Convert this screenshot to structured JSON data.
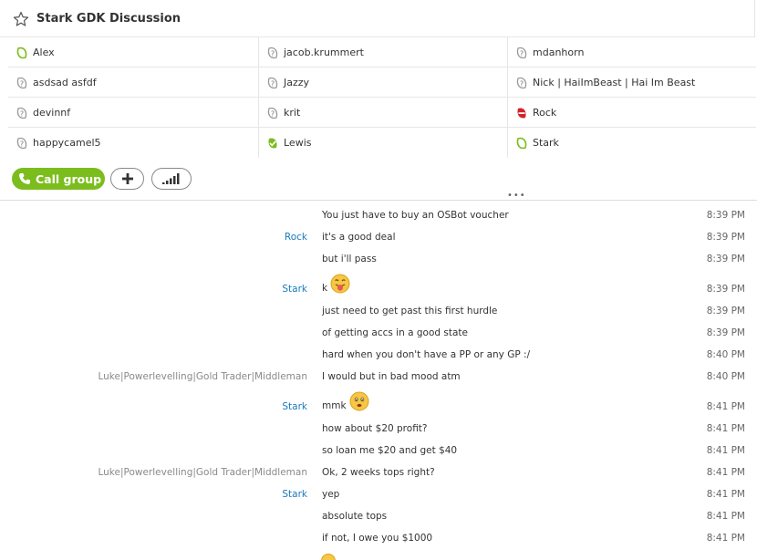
{
  "header": {
    "title": "Stark GDK Discussion"
  },
  "participants": [
    {
      "name": "Alex",
      "status": "online"
    },
    {
      "name": "jacob.krummert",
      "status": "unknown"
    },
    {
      "name": "mdanhorn",
      "status": "unknown"
    },
    {
      "name": "asdsad asfdf",
      "status": "unknown"
    },
    {
      "name": "Jazzy",
      "status": "unknown"
    },
    {
      "name": "Nick | HaiImBeast | Hai Im Beast",
      "status": "unknown"
    },
    {
      "name": "devinnf",
      "status": "unknown"
    },
    {
      "name": "krit",
      "status": "unknown"
    },
    {
      "name": "Rock",
      "status": "busy"
    },
    {
      "name": "happycamel5",
      "status": "unknown"
    },
    {
      "name": "Lewis",
      "status": "available"
    },
    {
      "name": "Stark",
      "status": "online"
    }
  ],
  "actions": {
    "call_group_label": "Call group"
  },
  "colors": {
    "accent_green": "#7cbd1e",
    "sender_blue": "#1a7bbf",
    "busy_red": "#d4222a"
  },
  "messages": [
    {
      "sender": "",
      "text": "You just have to buy an OSBot voucher",
      "time": "8:39 PM"
    },
    {
      "sender": "Rock",
      "text": "it's a good deal",
      "time": "8:39 PM"
    },
    {
      "sender": "",
      "text": "but i'll pass",
      "time": "8:39 PM"
    },
    {
      "sender": "Stark",
      "text": "k",
      "emoji": "tongue-emoji",
      "time": "8:39 PM"
    },
    {
      "sender": "",
      "text": "just need to get past this first hurdle",
      "time": "8:39 PM"
    },
    {
      "sender": "",
      "text": "of getting accs in a good state",
      "time": "8:39 PM"
    },
    {
      "sender": "",
      "text": "hard when you don't have a PP or any GP :/",
      "time": "8:40 PM"
    },
    {
      "sender": "Luke|Powerlevelling|Gold Trader|Middleman",
      "text": "I would but in bad mood atm",
      "time": "8:40 PM"
    },
    {
      "sender": "Stark",
      "text": "mmk",
      "emoji": "worried-emoji",
      "time": "8:41 PM"
    },
    {
      "sender": "",
      "text": "how about $20 profit?",
      "time": "8:41 PM"
    },
    {
      "sender": "",
      "text": "so loan me $20 and get $40",
      "time": "8:41 PM"
    },
    {
      "sender": "Luke|Powerlevelling|Gold Trader|Middleman",
      "text": "Ok, 2 weeks tops right?",
      "time": "8:41 PM"
    },
    {
      "sender": "Stark",
      "text": "yep",
      "time": "8:41 PM"
    },
    {
      "sender": "",
      "text": "absolute tops",
      "time": "8:41 PM"
    },
    {
      "sender": "",
      "text": "if not, I owe you $1000",
      "time": "8:41 PM"
    }
  ]
}
